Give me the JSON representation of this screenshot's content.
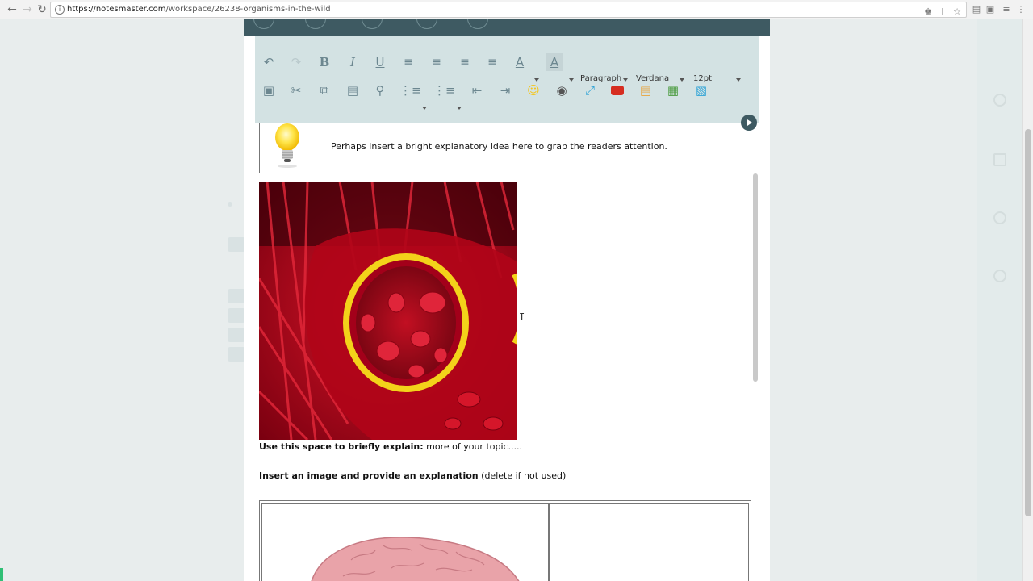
{
  "browser": {
    "url_host": "https://notesmaster.com",
    "url_path": "/workspace/26238-organisms-in-the-wild"
  },
  "toolbar": {
    "block_format": "Paragraph",
    "font_family": "Verdana",
    "font_size": "12pt",
    "bold_glyph": "B",
    "italic_glyph": "I",
    "underline_glyph": "U",
    "text_color_glyph": "A",
    "bg_color_glyph": "A"
  },
  "content": {
    "callout_text": "Perhaps insert a bright explanatory idea here to grab the readers attention.",
    "explain_bold": "Use this space to briefly explain:",
    "explain_rest": " more of your topic.....",
    "insert_bold": "Insert an image and provide an explanation",
    "insert_rest": " (delete if not used)"
  },
  "colors": {
    "topbar": "#3e5a62",
    "toolbar": "#d3e2e3",
    "icon": "#6c8790",
    "youtube": "#d62d20",
    "emoji": "#f5c518",
    "media": "#2ea3d6"
  }
}
